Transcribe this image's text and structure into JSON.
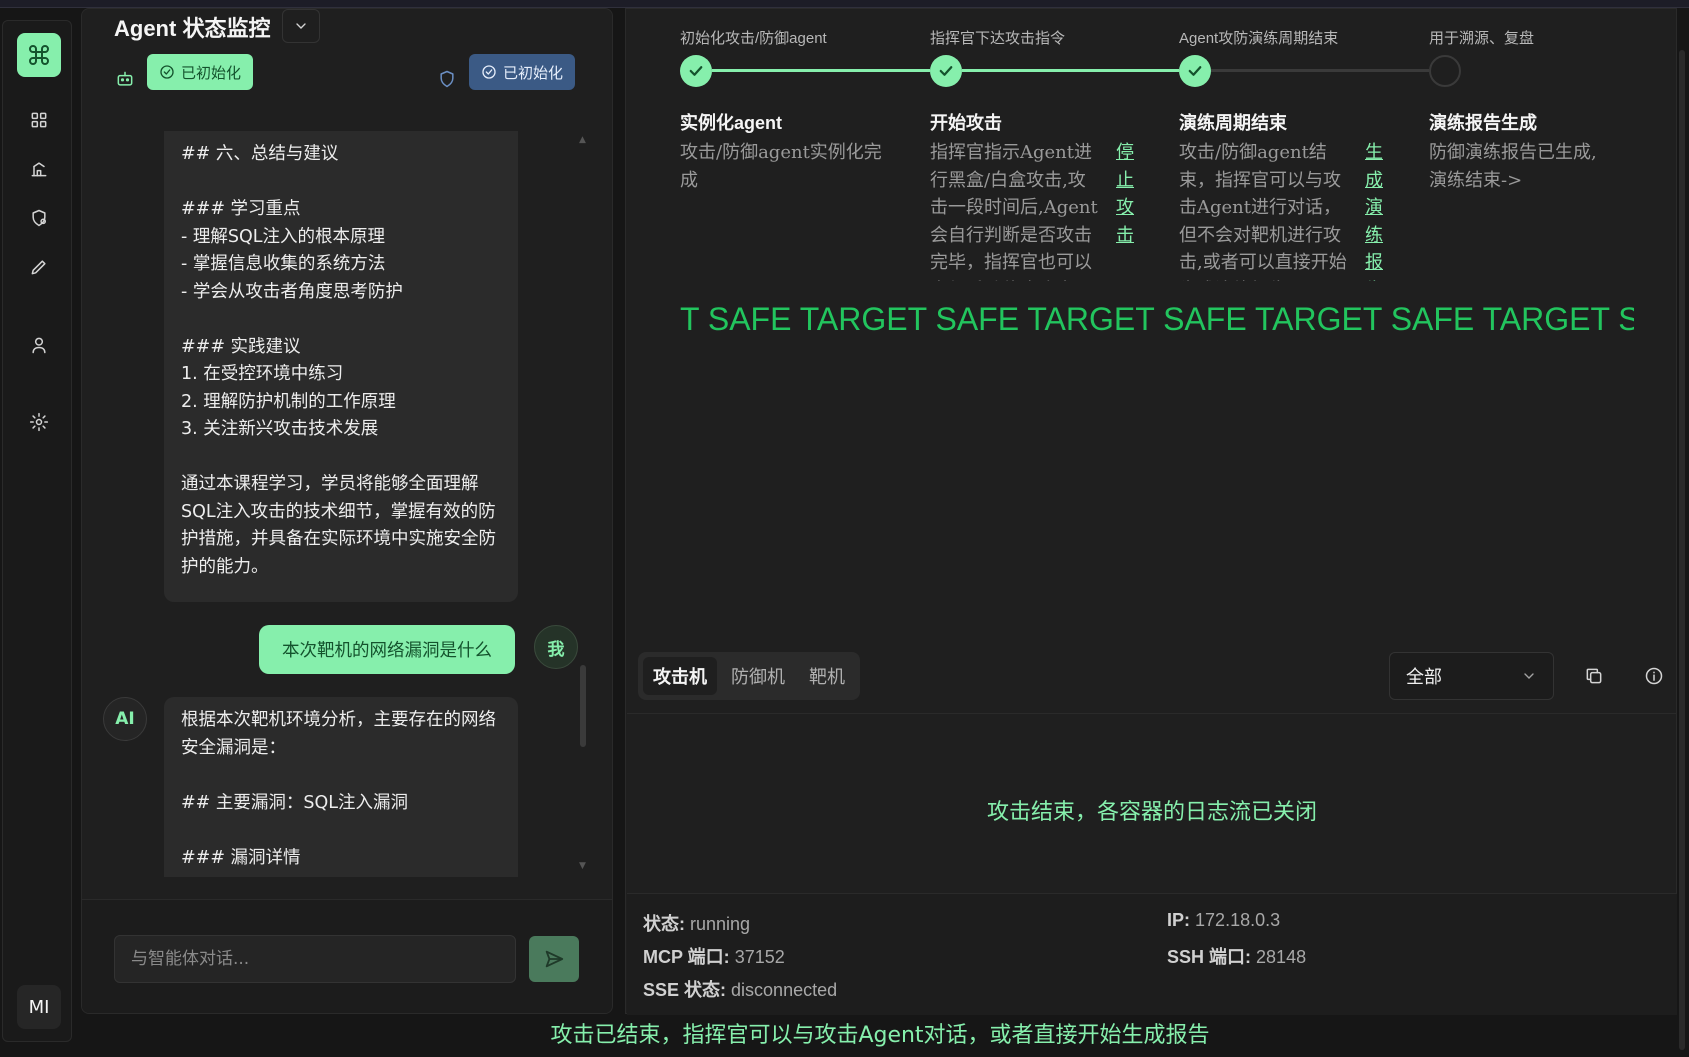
{
  "app": {
    "title": "Agent 状态监控"
  },
  "chat": {
    "status_pill_left": "已初始化",
    "status_pill_right": "已初始化",
    "messages": [
      {
        "role": "ai",
        "text": "## 六、总结与建议\n\n### 学习重点\n- 理解SQL注入的根本原理\n- 掌握信息收集的系统方法\n- 学会从攻击者角度思考防护\n\n### 实践建议\n1. 在受控环境中练习\n2. 理解防护机制的工作原理\n3. 关注新兴攻击技术发展\n\n通过本课程学习，学员将能够全面理解SQL注入攻击的技术细节，掌握有效的防护措施，并具备在实际环境中实施安全防护的能力。"
      },
      {
        "role": "me",
        "text": "本次靶机的网络漏洞是什么"
      },
      {
        "role": "ai",
        "text": "根据本次靶机环境分析，主要存在的网络安全漏洞是：\n\n## 主要漏洞：SQL注入漏洞\n\n### 漏洞详情"
      }
    ],
    "me_avatar": "我",
    "ai_avatar": "AI",
    "input_placeholder": "与智能体对话..."
  },
  "sidebar": {
    "user_initials": "MI",
    "icons": [
      "command-icon",
      "dashboard-icon",
      "chart-icon",
      "shield-icon",
      "pencil-icon",
      "user-icon",
      "gear-icon"
    ]
  },
  "steps": [
    {
      "top_label": "初始化攻击/防御agent",
      "title": "实例化agent",
      "desc": "攻击/防御agent实例化完成",
      "action": "",
      "status": "done"
    },
    {
      "top_label": "指挥官下达攻击指令",
      "title": "开始攻击",
      "desc": "指挥官指示Agent进行黑盒/白盒攻击,攻击一段时间后,Agent会自行判断是否攻击完毕，指挥官也可以自行手动停止攻击->",
      "action": "停止攻击",
      "status": "done"
    },
    {
      "top_label": "Agent攻防演练周期结束",
      "title": "演练周期结束",
      "desc": "攻击/防御agent结束，指挥官可以与攻击Agent进行对话，但不会对靶机进行攻击,或者可以直接开始生成演练报告->",
      "action": "生成演练报告",
      "status": "done"
    },
    {
      "top_label": "用于溯源、复盘",
      "title": "演练报告生成",
      "desc": "防御演练报告已生成,演练结束->",
      "action": "",
      "status": "todo"
    }
  ],
  "marquee_text": "T SAFE TARGET SAFE TARGET SAFE TARGET SAFE TARGET SAFE TARGET",
  "tabs": [
    "攻击机",
    "防御机",
    "靶机"
  ],
  "active_tab": "攻击机",
  "filter": {
    "selected": "全部"
  },
  "log_message": "攻击结束，各容器的日志流已关闭",
  "info": {
    "status_label": "状态:",
    "status_value": "running",
    "ip_label": "IP:",
    "ip_value": "172.18.0.3",
    "mcp_label": "MCP 端口:",
    "mcp_value": "37152",
    "ssh_label": "SSH 端口:",
    "ssh_value": "28148",
    "sse_label": "SSE 状态:",
    "sse_value": "disconnected"
  },
  "bottom_banner": "攻击已结束，指挥官可以与攻击Agent对话，或者直接开始生成报告",
  "colors": {
    "accent": "#86efac",
    "accent_dark": "#14532d",
    "marquee": "#22c55e",
    "blue_pill": "#3b5a85"
  }
}
